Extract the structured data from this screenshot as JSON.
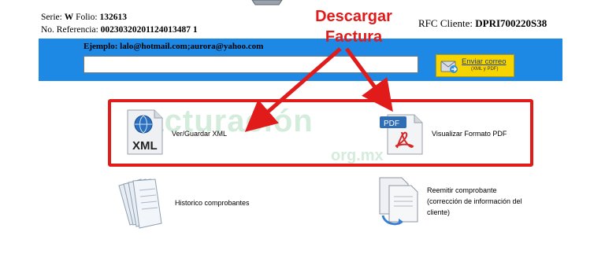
{
  "meta": {
    "serie_label": "Serie:",
    "serie_value": "W",
    "folio_label": "Folio:",
    "folio_value": "132613",
    "ref_label": "No. Referencia:",
    "ref_value": "00230320201124013487 1"
  },
  "rfc": {
    "label": "RFC Cliente:",
    "value": "DPRI700220S38"
  },
  "annotation": {
    "line1": "Descargar",
    "line2": "Factura",
    "color": "#e11a1a"
  },
  "email": {
    "hint": "Ejemplo: lalo@hotmail.com;aurora@yahoo.com",
    "value": "",
    "send_label": "Enviar correo",
    "send_sub": "(XML y PDF)"
  },
  "options": {
    "xml_label": "Ver/Guardar XML",
    "pdf_label": "Visualizar Formato PDF",
    "history_label": "Historico comprobantes",
    "resend_line1": "Reemitir comprobante",
    "resend_line2": "(corrección de información del",
    "resend_line3": "cliente)"
  },
  "watermark": {
    "main": "Facturación",
    "sub": "org.mx"
  },
  "colors": {
    "band": "#1e88e5",
    "button": "#f5d400",
    "highlight": "#e11a1a"
  },
  "icons": [
    "monitor-icon",
    "xml-file-icon",
    "pdf-file-icon",
    "documents-stack-icon",
    "document-copy-icon",
    "email-send-icon"
  ]
}
